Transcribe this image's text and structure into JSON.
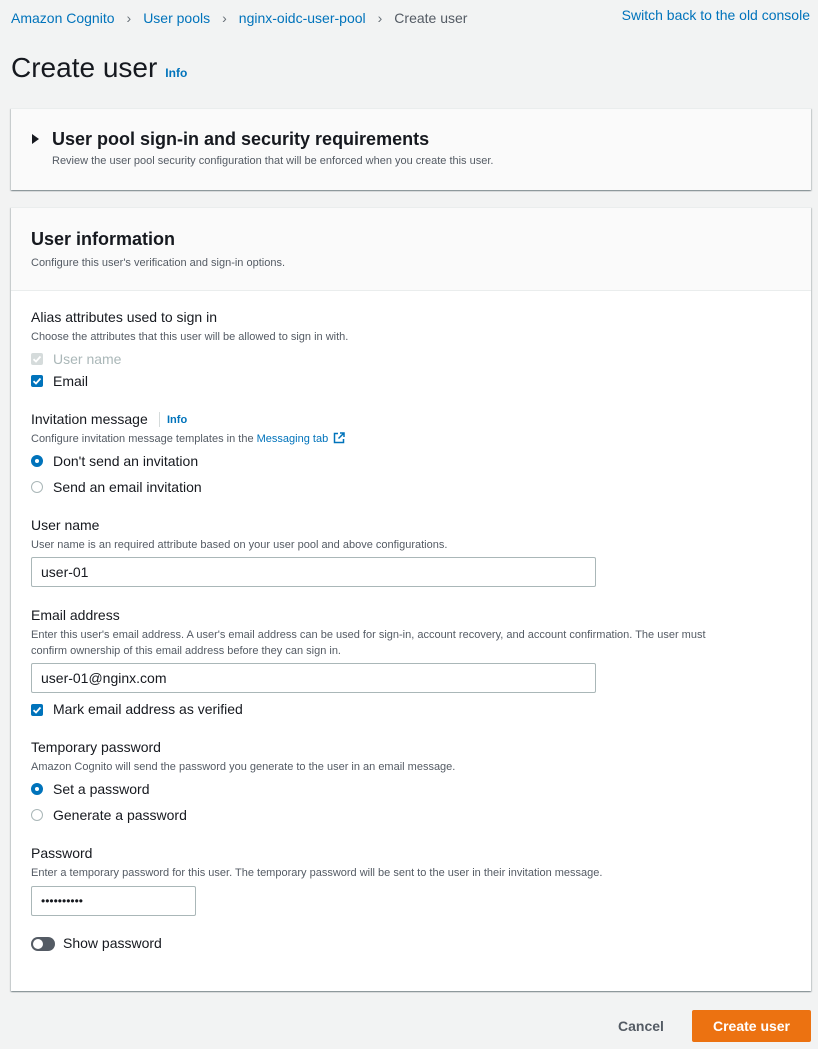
{
  "breadcrumb": {
    "items": [
      "Amazon Cognito",
      "User pools",
      "nginx-oidc-user-pool"
    ],
    "current": "Create user"
  },
  "header": {
    "switch_link": "Switch back to the old console",
    "title": "Create user",
    "info": "Info"
  },
  "security_panel": {
    "title": "User pool sign-in and security requirements",
    "description": "Review the user pool security configuration that will be enforced when you create this user.",
    "expanded": false
  },
  "user_info": {
    "title": "User information",
    "description": "Configure this user's verification and sign-in options.",
    "alias": {
      "label": "Alias attributes used to sign in",
      "description": "Choose the attributes that this user will be allowed to sign in with.",
      "options": [
        {
          "label": "User name",
          "checked": true,
          "disabled": true
        },
        {
          "label": "Email",
          "checked": true,
          "disabled": false
        }
      ]
    },
    "invitation": {
      "label": "Invitation message",
      "info": "Info",
      "description": "Configure invitation message templates in the",
      "link": "Messaging tab",
      "options": [
        {
          "label": "Don't send an invitation",
          "selected": true
        },
        {
          "label": "Send an email invitation",
          "selected": false
        }
      ]
    },
    "username": {
      "label": "User name",
      "description": "User name is an required attribute based on your user pool and above configurations.",
      "value": "user-01"
    },
    "email": {
      "label": "Email address",
      "description_line1": "Enter this user's email address. A user's email address can be used for sign-in, account recovery, and account confirmation. The user must",
      "description_line2": "confirm ownership of this email address before they can sign in.",
      "value": "user-01@nginx.com",
      "verified_label": "Mark email address as verified",
      "verified": true
    },
    "temp_password": {
      "label": "Temporary password",
      "description": "Amazon Cognito will send the password you generate to the user in an email message.",
      "options": [
        {
          "label": "Set a password",
          "selected": true
        },
        {
          "label": "Generate a password",
          "selected": false
        }
      ]
    },
    "password": {
      "label": "Password",
      "description": "Enter a temporary password for this user. The temporary password will be sent to the user in their invitation message.",
      "value": "••••••••••",
      "show_label": "Show password",
      "show": false
    }
  },
  "footer": {
    "cancel": "Cancel",
    "create": "Create user"
  },
  "colors": {
    "link": "#0073bb",
    "primary_button": "#ec7211",
    "checked": "#0073bb"
  }
}
